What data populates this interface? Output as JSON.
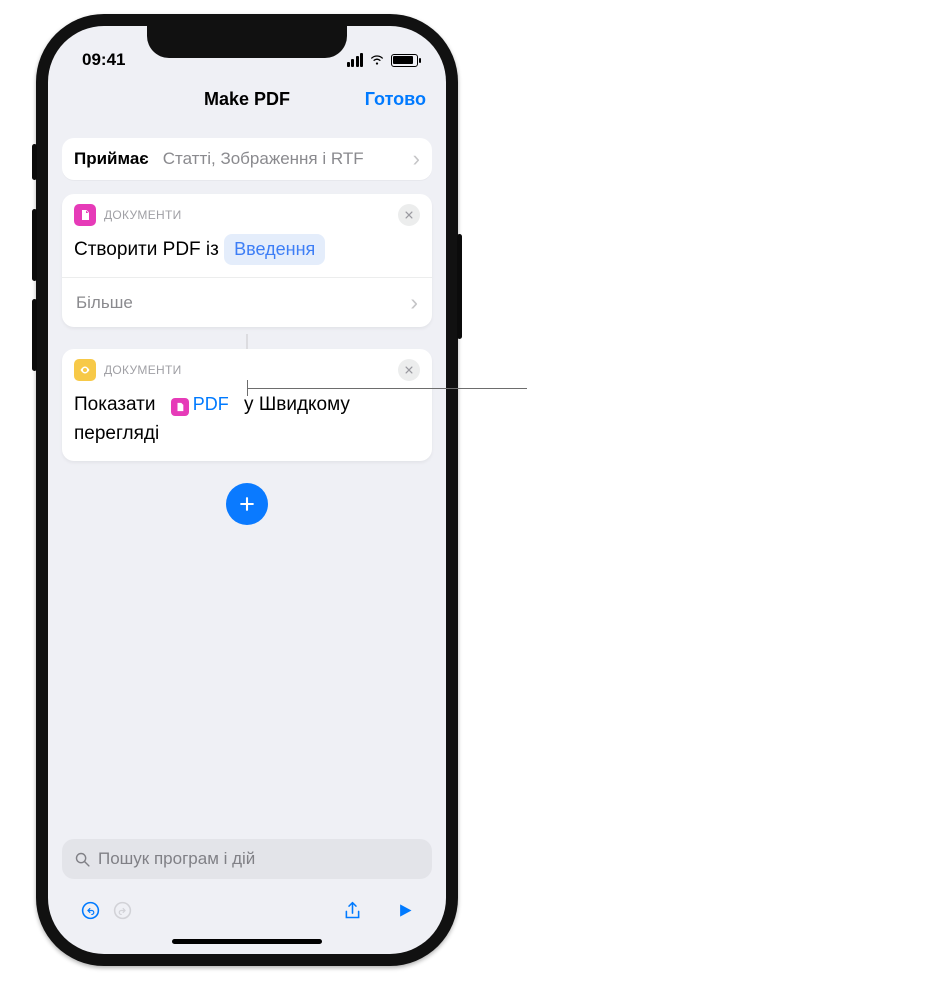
{
  "status": {
    "time": "09:41"
  },
  "nav": {
    "title": "Make PDF",
    "done": "Готово"
  },
  "accepts": {
    "label": "Приймає",
    "value": "Статті, Зображення і RTF"
  },
  "action1": {
    "category": "ДОКУМЕНТИ",
    "text_before": "Створити PDF із",
    "token": "Введення",
    "more": "Більше"
  },
  "action2": {
    "category": "ДОКУМЕНТИ",
    "text_before": "Показати",
    "token": "PDF",
    "text_after": "у Швидкому перегляді"
  },
  "search": {
    "placeholder": "Пошук програм і дій"
  },
  "colors": {
    "accent": "#007aff",
    "pink": "#e63bb8",
    "yellow": "#f7c948"
  }
}
